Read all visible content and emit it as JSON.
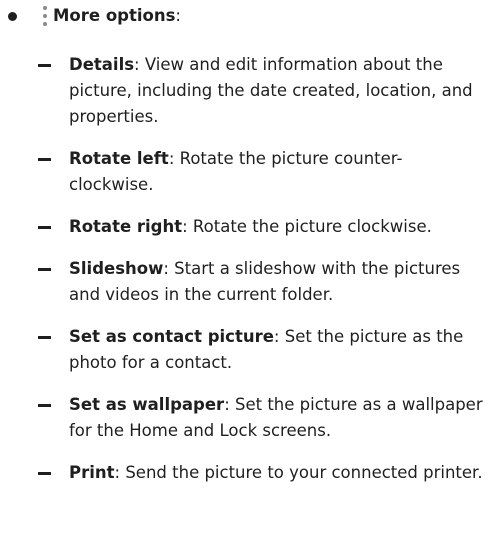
{
  "top": {
    "icon": "more-options-vertical-dots-icon",
    "label": "More options",
    "suffix": ":"
  },
  "items": [
    {
      "term": "Details",
      "desc": ": View and edit information about the picture, including the date created, location, and properties."
    },
    {
      "term": "Rotate left",
      "desc": ": Rotate the picture counter-clockwise."
    },
    {
      "term": "Rotate right",
      "desc": ": Rotate the picture clockwise."
    },
    {
      "term": "Slideshow",
      "desc": ": Start a slideshow with the pictures and videos in the current folder."
    },
    {
      "term": "Set as contact picture",
      "desc": ": Set the picture as the photo for a contact."
    },
    {
      "term": "Set as wallpaper",
      "desc": ": Set the picture as a wallpaper for the Home and Lock screens."
    },
    {
      "term": "Print",
      "desc": ": Send the picture to your connected printer."
    }
  ]
}
